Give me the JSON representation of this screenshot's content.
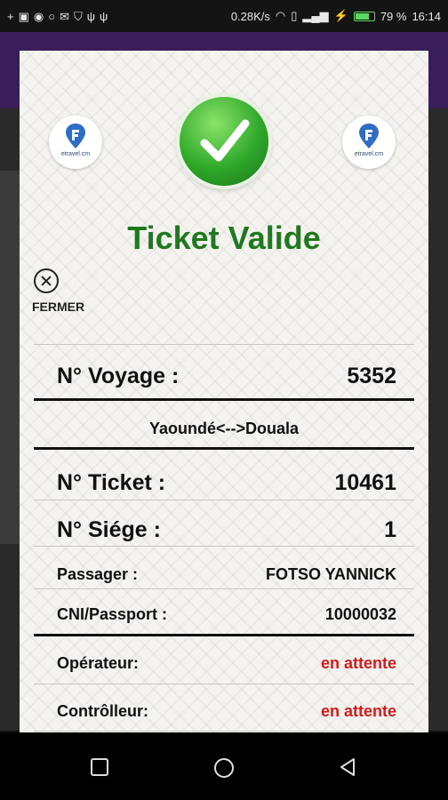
{
  "status_bar": {
    "left_icons": [
      "plus-icon",
      "facebook-icon",
      "messenger-icon",
      "whatsapp-icon",
      "mail-icon",
      "shield-icon",
      "usb-icon",
      "usb-icon-2"
    ],
    "network_speed": "0.28K/s",
    "battery_percent": "79 %",
    "time": "16:14"
  },
  "dialog": {
    "logo_text": "etravel.cm",
    "title": "Ticket Valide",
    "close_label": "FERMER",
    "voyage_label": "N° Voyage :",
    "voyage_value": "5352",
    "route": "Yaoundé<-->Douala",
    "ticket_label": "N° Ticket :",
    "ticket_value": "10461",
    "seat_label": "N° Siége :",
    "seat_value": "1",
    "passenger_label": "Passager :",
    "passenger_value": "FOTSO YANNICK",
    "id_label": "CNI/Passport :",
    "id_value": "10000032",
    "operator_label": "Opérateur:",
    "operator_value": "en attente",
    "controller_label": "Contrôlleur:",
    "controller_value": "en attente"
  },
  "colors": {
    "title_green": "#1f7a1f",
    "status_red": "#d01c1c",
    "purple": "#3a1e5c"
  }
}
